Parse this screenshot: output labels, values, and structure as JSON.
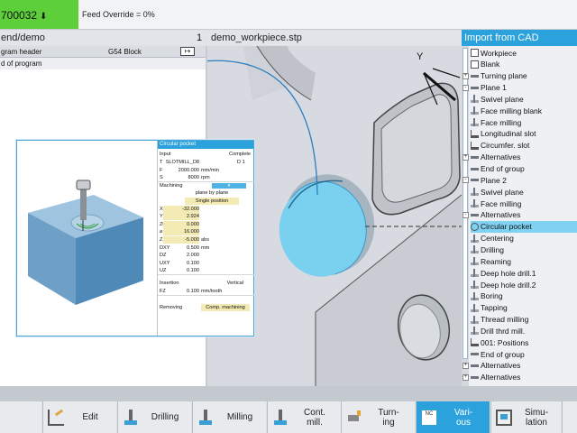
{
  "topbar": {
    "program_id": "700032",
    "program_arrow": "⬇",
    "feed_override": "Feed Override = 0%"
  },
  "header": {
    "left_title": "end/demo",
    "channel_num": "1",
    "center_title": "demo_workpiece.stp",
    "right_title": "Import from CAD"
  },
  "editor": {
    "rows": [
      {
        "label": "gram header",
        "extra": "G54 Block",
        "icon": "return-icon"
      },
      {
        "label": "d of program"
      }
    ]
  },
  "view3d": {
    "axis_label": "Y"
  },
  "tree": {
    "items": [
      {
        "label": "Workpiece",
        "icon": "workpiece-icon",
        "expander": ""
      },
      {
        "label": "Blank",
        "icon": "blank-icon",
        "expander": ""
      },
      {
        "label": "Turning plane",
        "icon": "plane-icon",
        "expander": "+"
      },
      {
        "label": "Plane 1",
        "icon": "plane-icon",
        "expander": "-"
      },
      {
        "label": "Swivel plane",
        "icon": "swivel-icon",
        "expander": ""
      },
      {
        "label": "Face milling blank",
        "icon": "face-mill-icon",
        "expander": ""
      },
      {
        "label": "Face milling",
        "icon": "face-mill-icon",
        "expander": ""
      },
      {
        "label": "Longitudinal slot",
        "icon": "slot-icon",
        "expander": ""
      },
      {
        "label": "Circumfer. slot",
        "icon": "slot-icon",
        "expander": ""
      },
      {
        "label": "Alternatives",
        "icon": "group-icon",
        "expander": "+"
      },
      {
        "label": "End of group",
        "icon": "group-end-icon",
        "expander": ""
      },
      {
        "label": "Plane 2",
        "icon": "plane-icon",
        "expander": "-"
      },
      {
        "label": "Swivel plane",
        "icon": "swivel-icon",
        "expander": ""
      },
      {
        "label": "Face milling",
        "icon": "face-mill-icon",
        "expander": ""
      },
      {
        "label": "Alternatives",
        "icon": "group-icon",
        "expander": "-"
      },
      {
        "label": "Circular pocket",
        "icon": "circle-pocket-icon",
        "expander": "",
        "selected": true
      },
      {
        "label": "Centering",
        "icon": "drill-icon",
        "expander": ""
      },
      {
        "label": "Drilling",
        "icon": "drill-icon",
        "expander": ""
      },
      {
        "label": "Reaming",
        "icon": "drill-icon",
        "expander": ""
      },
      {
        "label": "Deep hole drill.1",
        "icon": "drill-icon",
        "expander": ""
      },
      {
        "label": "Deep hole drill.2",
        "icon": "drill-icon",
        "expander": ""
      },
      {
        "label": "Boring",
        "icon": "drill-icon",
        "expander": ""
      },
      {
        "label": "Tapping",
        "icon": "drill-icon",
        "expander": ""
      },
      {
        "label": "Thread milling",
        "icon": "drill-icon",
        "expander": ""
      },
      {
        "label": "Drill thrd mill.",
        "icon": "drill-icon",
        "expander": ""
      },
      {
        "label": "001: Positions",
        "icon": "positions-icon",
        "expander": ""
      },
      {
        "label": "End of group",
        "icon": "group-end-icon",
        "expander": ""
      },
      {
        "label": "Alternatives",
        "icon": "group-icon",
        "expander": "+"
      },
      {
        "label": "Alternatives",
        "icon": "group-icon",
        "expander": "+"
      }
    ]
  },
  "form": {
    "title": "Circular pocket",
    "input_label": "Input",
    "input_value": "Complete",
    "rows": [
      {
        "label": "T",
        "value": "SLOTMILL_D8",
        "unit": "D 1"
      },
      {
        "label": "F",
        "value": "2000.000",
        "unit": "mm/min"
      },
      {
        "label": "S",
        "value": "8000",
        "unit": "rpm"
      },
      {
        "label": "Machining",
        "value": "▾",
        "unit": ""
      },
      {
        "label": "",
        "value": "plane by plane",
        "unit": ""
      },
      {
        "label": "",
        "value": "Single position",
        "unit": ""
      },
      {
        "label": "X0",
        "value": "-32.000",
        "unit": ""
      },
      {
        "label": "Y0",
        "value": "2.924",
        "unit": ""
      },
      {
        "label": "Z0",
        "value": "0.000",
        "unit": ""
      },
      {
        "label": "⌀",
        "value": "16.000",
        "unit": ""
      },
      {
        "label": "Z1",
        "value": "-5.000",
        "unit": "abs"
      },
      {
        "label": "DXY",
        "value": "0.500",
        "unit": "mm"
      },
      {
        "label": "DZ",
        "value": "2.000",
        "unit": ""
      },
      {
        "label": "UXY",
        "value": "0.100",
        "unit": ""
      },
      {
        "label": "UZ",
        "value": "0.100",
        "unit": ""
      },
      {
        "label": "Insertion",
        "value": "Vertical",
        "unit": ""
      },
      {
        "label": "FZ",
        "value": "0.100",
        "unit": "mm/tooth"
      },
      {
        "label": "Removing",
        "value": "Comp. machining",
        "unit": ""
      }
    ]
  },
  "softkeys": [
    {
      "label": "Edit",
      "icon": "edit-icon"
    },
    {
      "label": "Drilling",
      "icon": "drilling-icon"
    },
    {
      "label": "Milling",
      "icon": "milling-icon"
    },
    {
      "label": "Cont.\nmill.",
      "icon": "contour-mill-icon"
    },
    {
      "label": "Turn-\ning",
      "icon": "turning-icon"
    },
    {
      "label": "Vari-\nous",
      "icon": "nc-icon",
      "active": true
    },
    {
      "label": "Simu-\nlation",
      "icon": "simulation-icon"
    }
  ],
  "colors": {
    "accent": "#2ba2db",
    "program_badge": "#5ccf3b",
    "highlight_field": "#f3eab4",
    "pocket": "#7ad0ef"
  }
}
